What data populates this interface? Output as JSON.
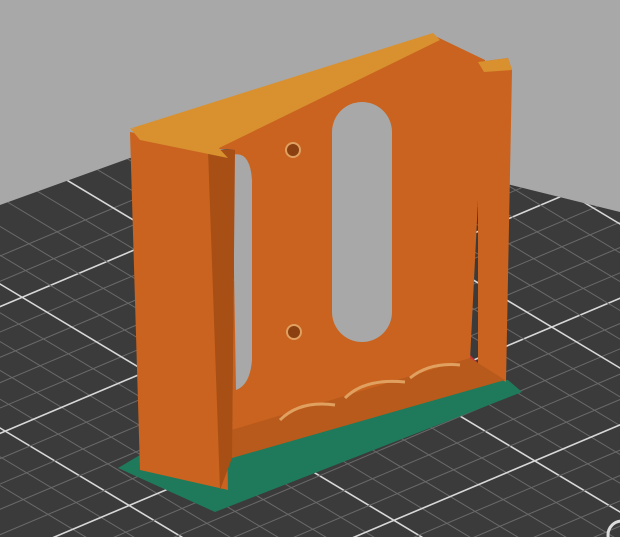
{
  "viewport": {
    "view": "3d-preview",
    "colors": {
      "background": "#a8a8a8",
      "bed": "#3c3c3c",
      "grid_minor": "#6a6a6a",
      "grid_major": "#d8d8d8",
      "perimeter": "#c9631f",
      "perimeter_dark": "#a84f15",
      "top_edge": "#d9902f",
      "infill": "#c8343a",
      "skirt": "#1e7a5a"
    }
  }
}
